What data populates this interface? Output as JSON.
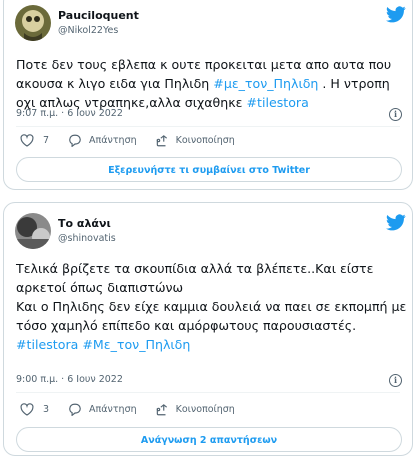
{
  "tweets": [
    {
      "display_name": "Pauciloquent",
      "handle": "@Nikol22Yes",
      "text_parts": [
        {
          "t": "Ποτε δεν τους εβλεπα κ ουτε προκειται μετα απο αυτα που ακουσα κ λιγο ειδα για Πηλιδη ",
          "link": false
        },
        {
          "t": "#με_τον_Πηλιδη",
          "link": true
        },
        {
          "t": " . Η ντροπη οχι απλως ντραπηκε,αλλα σιχαθηκε  ",
          "link": false
        },
        {
          "t": "#tilestora",
          "link": true
        }
      ],
      "timestamp": "9:07 π.μ. · 6 Ιουν 2022",
      "like_count": "7",
      "reply_label": "Απάντηση",
      "share_label": "Κοινοποίηση",
      "footer_button": "Εξερευνήστε τι συμβαίνει στο Twitter"
    },
    {
      "display_name": "Το αλάνι",
      "handle": "@shinovatis",
      "lines": [
        [
          {
            "t": "Τελικά βρίζετε τα σκουπίδια αλλά τα βλέπετε..Και είστε αρκετοί όπως διαπιστώνω",
            "link": false
          }
        ],
        [
          {
            "t": "Και ο Πηλιδης δεν είχε καμμια δουλειά να παει σε εκπομπή με τόσο χαμηλό επίπεδο και αμόρφωτους παρουσιαστές.",
            "link": false
          }
        ],
        [
          {
            "t": "#tilestora",
            "link": true
          },
          {
            "t": " ",
            "link": false
          },
          {
            "t": "#Με_τον_Πηλιδη",
            "link": true
          }
        ]
      ],
      "timestamp": "9:00 π.μ. · 6 Ιουν 2022",
      "like_count": "3",
      "reply_label": "Απάντηση",
      "share_label": "Κοινοποίηση",
      "footer_button": "Ανάγνωση 2 απαντήσεων"
    }
  ],
  "colors": {
    "accent": "#1d9bf0",
    "text": "#0f1419",
    "muted": "#536471",
    "border": "#cfd9de"
  },
  "icons": [
    "twitter-bird-icon",
    "heart-icon",
    "reply-icon",
    "share-icon",
    "info-icon"
  ]
}
